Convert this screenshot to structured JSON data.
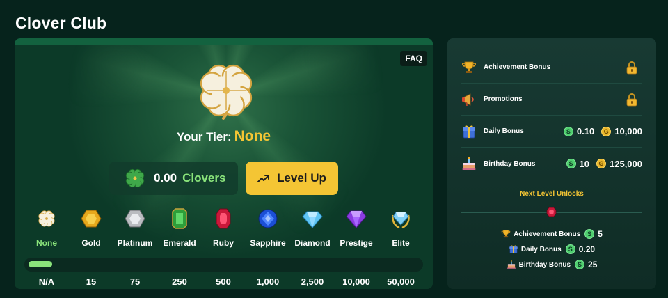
{
  "page": {
    "title": "Clover Club"
  },
  "main": {
    "faq_label": "FAQ",
    "your_tier_label": "Your Tier:",
    "current_tier": "None",
    "clovers_amount": "0.00",
    "clovers_label": "Clovers",
    "level_up_label": "Level Up",
    "progress_fraction": 0.06,
    "tiers": [
      {
        "name": "None",
        "threshold": "N/A",
        "icon": "clover-icon",
        "active": true
      },
      {
        "name": "Gold",
        "threshold": "15",
        "icon": "gold-gem-icon"
      },
      {
        "name": "Platinum",
        "threshold": "75",
        "icon": "platinum-gem-icon"
      },
      {
        "name": "Emerald",
        "threshold": "250",
        "icon": "emerald-gem-icon"
      },
      {
        "name": "Ruby",
        "threshold": "500",
        "icon": "ruby-gem-icon"
      },
      {
        "name": "Sapphire",
        "threshold": "1,000",
        "icon": "sapphire-gem-icon"
      },
      {
        "name": "Diamond",
        "threshold": "2,500",
        "icon": "diamond-gem-icon"
      },
      {
        "name": "Prestige",
        "threshold": "10,000",
        "icon": "prestige-gem-icon"
      },
      {
        "name": "Elite",
        "threshold": "50,000",
        "icon": "elite-gem-icon"
      }
    ]
  },
  "benefits": [
    {
      "label": "Achievement Bonus",
      "icon": "trophy-icon",
      "locked": true
    },
    {
      "label": "Promotions",
      "icon": "megaphone-icon",
      "locked": true
    },
    {
      "label": "Daily Bonus",
      "icon": "gift-icon",
      "sc": "0.10",
      "gc": "10,000"
    },
    {
      "label": "Birthday Bonus",
      "icon": "cake-icon",
      "sc": "10",
      "gc": "125,000"
    }
  ],
  "next_level": {
    "title": "Next Level Unlocks",
    "items": [
      {
        "label": "Achievement Bonus",
        "icon": "trophy-icon",
        "sc": "5"
      },
      {
        "label": "Daily Bonus",
        "icon": "gift-icon",
        "sc": "0.20"
      },
      {
        "label": "Birthday Bonus",
        "icon": "cake-icon",
        "sc": "25"
      }
    ]
  },
  "currency": {
    "sc_symbol": "S",
    "gc_symbol": "G"
  },
  "colors": {
    "accent_yellow": "#f4c534",
    "accent_green": "#8ae47b",
    "background": "#06231c"
  }
}
